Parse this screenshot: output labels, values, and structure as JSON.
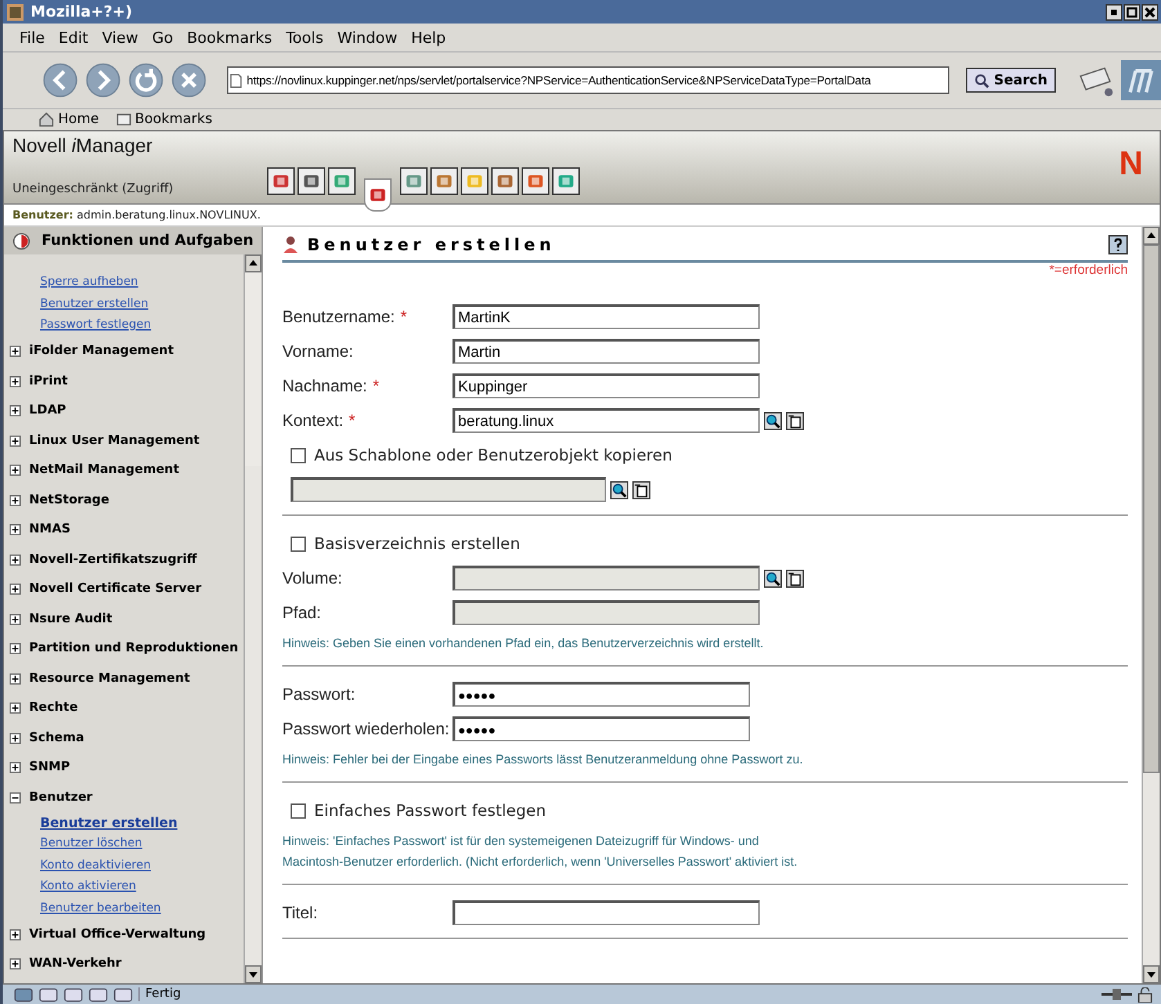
{
  "window": {
    "title": "Mozilla+?+)"
  },
  "menu": [
    "File",
    "Edit",
    "View",
    "Go",
    "Bookmarks",
    "Tools",
    "Window",
    "Help"
  ],
  "navigation": {
    "url": "https://novlinux.kuppinger.net/nps/servlet/portalservice?NPService=AuthenticationService&NPServiceDataType=PortalData",
    "search_button": "Search"
  },
  "personal_bar": [
    "Home",
    "Bookmarks"
  ],
  "imanager": {
    "title": "Novell ",
    "title_italic": "i",
    "title_end": "Manager",
    "role": "Uneingeschränkt (Zugriff)",
    "logo": "N",
    "toolbar": [
      {
        "selected": false
      },
      {
        "selected": false
      },
      {
        "selected": false
      },
      {
        "selected": true
      },
      {
        "selected": false
      },
      {
        "selected": false
      },
      {
        "selected": false
      },
      {
        "selected": false
      },
      {
        "selected": false
      },
      {
        "selected": false
      }
    ],
    "user_label": "Benutzer:",
    "user": "admin.beratung.linux.NOVLINUX."
  },
  "sidebar": {
    "header": "Funktionen und Aufgaben",
    "top_links": [
      {
        "label": "Sperre aufheben",
        "selected": false
      },
      {
        "label": "Benutzer erstellen",
        "selected": false
      },
      {
        "label": "Passwort festlegen",
        "selected": false
      }
    ],
    "groups": [
      {
        "label": "iFolder Management",
        "expanded": false
      },
      {
        "label": "iPrint",
        "expanded": false
      },
      {
        "label": "LDAP",
        "expanded": false
      },
      {
        "label": "Linux User Management",
        "expanded": false
      },
      {
        "label": "NetMail Management",
        "expanded": false
      },
      {
        "label": "NetStorage",
        "expanded": false
      },
      {
        "label": "NMAS",
        "expanded": false
      },
      {
        "label": "Novell-Zertifikatszugriff",
        "expanded": false
      },
      {
        "label": "Novell Certificate Server",
        "expanded": false
      },
      {
        "label": "Nsure Audit",
        "expanded": false
      },
      {
        "label": "Partition und Reproduktionen",
        "expanded": false
      },
      {
        "label": "Resource Management",
        "expanded": false
      },
      {
        "label": "Rechte",
        "expanded": false
      },
      {
        "label": "Schema",
        "expanded": false
      },
      {
        "label": "SNMP",
        "expanded": false
      },
      {
        "label": "Benutzer",
        "expanded": true,
        "children": [
          {
            "label": "Benutzer erstellen",
            "selected": true
          },
          {
            "label": "Benutzer löschen",
            "selected": false
          },
          {
            "label": "Konto deaktivieren",
            "selected": false
          },
          {
            "label": "Konto aktivieren",
            "selected": false
          },
          {
            "label": "Benutzer bearbeiten",
            "selected": false
          }
        ]
      },
      {
        "label": "Virtual Office-Verwaltung",
        "expanded": false
      },
      {
        "label": "WAN-Verkehr",
        "expanded": false
      }
    ]
  },
  "form": {
    "title": "Benutzer erstellen",
    "required_note": "*=erforderlich",
    "sections": [
      {
        "rows": [
          {
            "kind": "field",
            "label": "Benutzername:",
            "required_mark": "*",
            "value": "MartinK",
            "disabled": false,
            "browse": false
          },
          {
            "kind": "field",
            "label": "Vorname:",
            "value": "Martin",
            "disabled": false,
            "browse": false
          },
          {
            "kind": "field",
            "label": "Nachname:",
            "required_mark": "*",
            "value": "Kuppinger",
            "disabled": false,
            "browse": false
          },
          {
            "kind": "field",
            "label": "Kontext:",
            "required_mark": "*",
            "value": "beratung.linux",
            "disabled": false,
            "browse": true
          },
          {
            "kind": "checkbox",
            "label": "Aus Schablone oder Benutzerobjekt kopieren",
            "checked": false
          },
          {
            "kind": "bare_field",
            "disabled": true,
            "browse": true
          }
        ]
      },
      {
        "rows": [
          {
            "kind": "checkbox",
            "label": "Basisverzeichnis erstellen",
            "checked": false
          },
          {
            "kind": "field",
            "label": "Volume:",
            "disabled": true,
            "browse": true
          },
          {
            "kind": "field",
            "label": "Pfad:",
            "disabled": true,
            "browse": false
          },
          {
            "kind": "hint",
            "text": "Hinweis: Geben Sie einen vorhandenen Pfad ein, das Benutzerverzeichnis wird erstellt."
          }
        ]
      },
      {
        "rows": [
          {
            "kind": "password",
            "label": "Passwort:",
            "value": "●●●●●"
          },
          {
            "kind": "password",
            "label": "Passwort wiederholen:",
            "value": "●●●●●"
          },
          {
            "kind": "hint",
            "text": "Hinweis: Fehler bei der Eingabe eines Passworts lässt Benutzeranmeldung ohne Passwort zu."
          }
        ]
      },
      {
        "rows": [
          {
            "kind": "checkbox",
            "label": "Einfaches Passwort festlegen",
            "checked": false
          },
          {
            "kind": "hint",
            "text": "Hinweis: 'Einfaches Passwort' ist für den systemeigenen Dateizugriff für Windows- und Macintosh-Benutzer erforderlich. (Nicht erforderlich, wenn 'Universelles Passwort' aktiviert ist."
          }
        ]
      },
      {
        "rows": [
          {
            "kind": "field",
            "label": "Titel:",
            "disabled": false,
            "browse": false
          }
        ]
      }
    ]
  },
  "status_bar": {
    "text": "Fertig"
  }
}
